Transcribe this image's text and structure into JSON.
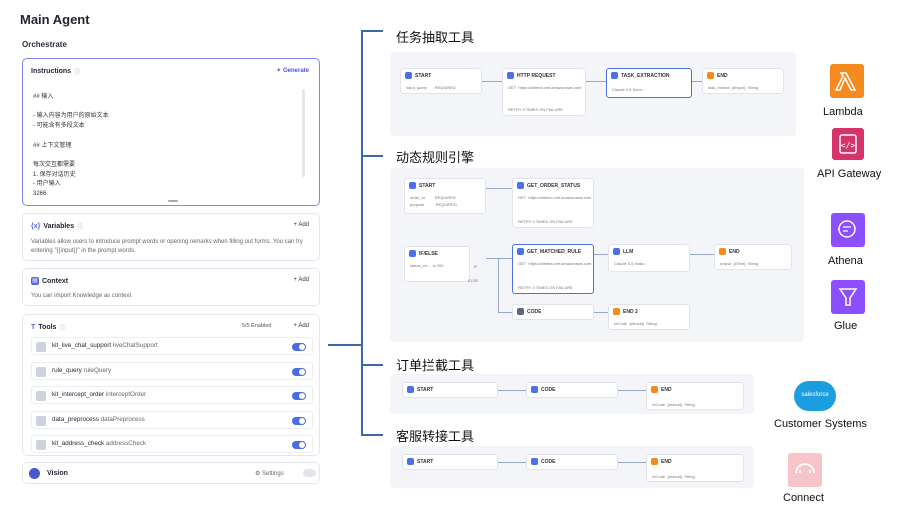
{
  "agent": {
    "title": "Main Agent",
    "mode": "Orchestrate",
    "instructions": {
      "label": "Instructions",
      "generate": "Generate",
      "body": [
        "## 输入",
        "",
        "- 输入内容为用户的原始文本",
        "- 可能含有多段文本",
        "",
        "## 上下文管理",
        "",
        "每次交互都需要",
        "1. 保存对话历史",
        "- 用户输入",
        "3266"
      ]
    },
    "variables": {
      "label": "Variables",
      "add": "+ Add",
      "desc": "Variables allow users to introduce prompt words or opening remarks when filling out forms. You can try entering \"{{input}}\" in the prompt words."
    },
    "context": {
      "label": "Context",
      "add": "+ Add",
      "desc": "You can import Knowledge as context"
    },
    "tools": {
      "label": "Tools",
      "enabled": "5/5 Enabled",
      "add": "+ Add",
      "items": [
        {
          "name": "kit_live_chat_support",
          "alias": "liveChatSupport"
        },
        {
          "name": "rule_query",
          "alias": "ruleQuery"
        },
        {
          "name": "kit_intercept_order",
          "alias": "interceptOrder"
        },
        {
          "name": "data_preprocess",
          "alias": "dataPreprocess"
        },
        {
          "name": "kit_address_check",
          "alias": "addressCheck"
        }
      ]
    },
    "vision": {
      "label": "Vision",
      "settings": "Settings"
    }
  },
  "workflows": [
    {
      "title": "任务抽取工具",
      "nodes": [
        "START",
        "HTTP REQUEST",
        "TASK_EXTRACTION",
        "END"
      ]
    },
    {
      "title": "动态规则引擎",
      "nodes": [
        "START",
        "GET_ORDER_STATUS",
        "IF/ELSE",
        "GET_MATCHED_RULE",
        "LLM",
        "END",
        "CODE",
        "END 2"
      ]
    },
    {
      "title": "订单拦截工具",
      "nodes": [
        "START",
        "CODE",
        "END"
      ]
    },
    {
      "title": "客服转接工具",
      "nodes": [
        "START",
        "CODE",
        "END"
      ]
    }
  ],
  "node_text": {
    "input_query": "input_query",
    "required": "REQUIRED",
    "get_url": "GET  https://athena.cmf.amazonaws.com",
    "retry": "RETRY 3 TIMES ON FAILURE",
    "claude": "Claude 3.5 Sonn...",
    "task_output": "task_extract  {#Input}  String",
    "order_id": "order_id",
    "purpose": "purpose",
    "ifelse_var": "status_co...  is 200",
    "if_label": "IF",
    "else_label": "ELSE",
    "llm_model": "Claude 3.5 Haiku",
    "end_out": "output  {#Text}  String",
    "code_out": "reCode  {#result}  String"
  },
  "services": [
    {
      "name": "Lambda",
      "color": "#f58a1f",
      "icon": "lambda-icon"
    },
    {
      "name": "API Gateway",
      "color": "#d6336c",
      "icon": "api-gateway-icon"
    },
    {
      "name": "Athena",
      "color": "#8c4fff",
      "icon": "athena-icon"
    },
    {
      "name": "Glue",
      "color": "#8c4fff",
      "icon": "glue-icon"
    },
    {
      "name": "Customer Systems",
      "color": "#1b9ee0",
      "icon": "salesforce-icon",
      "badge": "salesforce"
    },
    {
      "name": "Connect",
      "color": "#e8808a",
      "icon": "connect-icon"
    }
  ]
}
